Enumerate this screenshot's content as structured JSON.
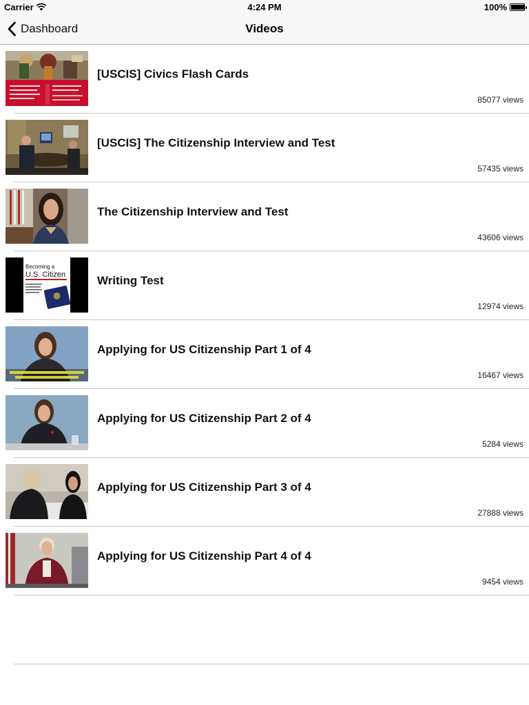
{
  "status_bar": {
    "carrier": "Carrier",
    "time": "4:24 PM",
    "battery": "100%",
    "battery_level": 1.0
  },
  "nav": {
    "back_label": "Dashboard",
    "title": "Videos"
  },
  "videos": [
    {
      "title": "[USCIS] Civics Flash Cards",
      "views": "85077 views",
      "thumb": "civics-flash-cards-thumbnail"
    },
    {
      "title": "[USCIS] The Citizenship Interview and Test",
      "views": "57435 views",
      "thumb": "office-interview-thumbnail"
    },
    {
      "title": "The Citizenship Interview and Test",
      "views": "43606 views",
      "thumb": "woman-speaker-thumbnail"
    },
    {
      "title": "Writing Test",
      "views": "12974 views",
      "thumb": "becoming-a-us-citizen-book-thumbnail"
    },
    {
      "title": "Applying for US Citizenship Part 1 of 4",
      "views": "16467 views",
      "thumb": "attorney-part1-thumbnail"
    },
    {
      "title": "Applying for US Citizenship Part 2 of 4",
      "views": "5284 views",
      "thumb": "attorney-part2-thumbnail"
    },
    {
      "title": "Applying for US Citizenship Part 3 of 4",
      "views": "27888 views",
      "thumb": "interview-part3-thumbnail"
    },
    {
      "title": "Applying for US Citizenship Part 4 of 4",
      "views": "9454 views",
      "thumb": "officer-part4-thumbnail"
    }
  ],
  "thumbnail_texts": {
    "book_title_line1": "Becoming a",
    "book_title_line2": "U.S. Citizen"
  }
}
